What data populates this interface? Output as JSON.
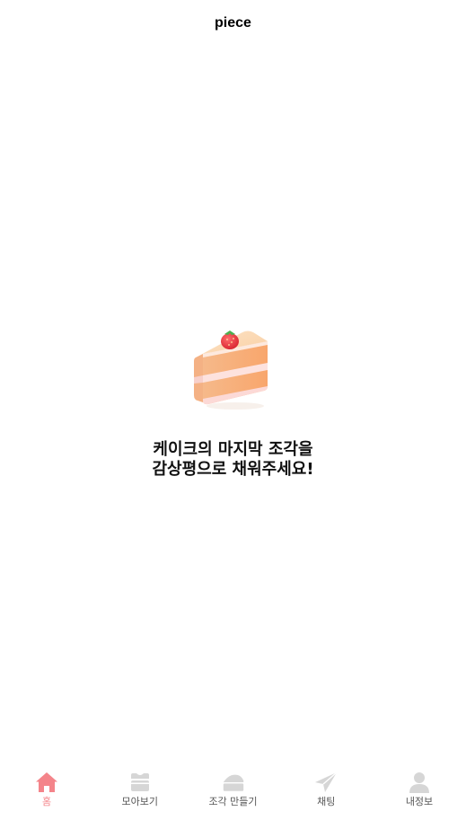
{
  "header": {
    "title": "piece"
  },
  "empty_state": {
    "illustration": "cake-slice-icon",
    "message_line1": "케이크의 마지막 조각을",
    "message_line2": "감상평으로 채워주세요!"
  },
  "tab_bar": {
    "active_color": "#f4848a",
    "inactive_icon_color": "#d6d6d6",
    "items": [
      {
        "label": "홈",
        "icon": "home-icon",
        "active": true
      },
      {
        "label": "모아보기",
        "icon": "cake-box-icon",
        "active": false
      },
      {
        "label": "조각 만들기",
        "icon": "cake-piece-icon",
        "active": false
      },
      {
        "label": "채팅",
        "icon": "paper-plane-icon",
        "active": false
      },
      {
        "label": "내정보",
        "icon": "person-icon",
        "active": false
      }
    ]
  }
}
